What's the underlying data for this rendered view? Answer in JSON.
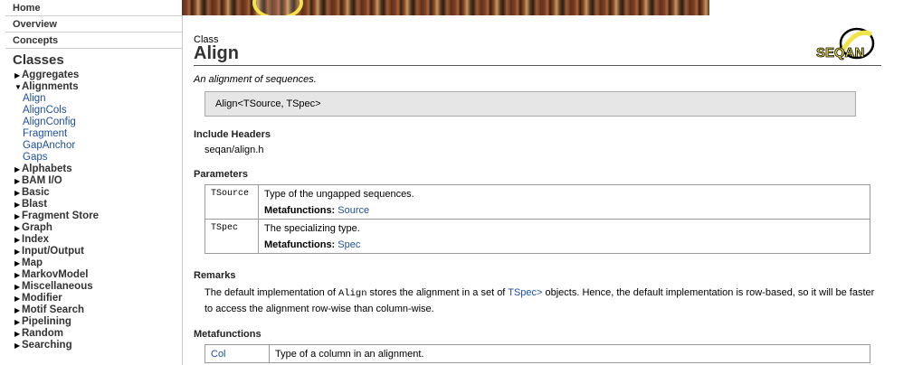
{
  "nav": {
    "links": [
      "Home",
      "Overview",
      "Concepts"
    ],
    "classes_heading": "Classes",
    "tree": [
      {
        "label": "Aggregates",
        "expanded": false
      },
      {
        "label": "Alignments",
        "expanded": true,
        "children": [
          "Align",
          "AlignCols",
          "AlignConfig",
          "Fragment",
          "GapAnchor",
          "Gaps"
        ]
      },
      {
        "label": "Alphabets",
        "expanded": false
      },
      {
        "label": "BAM I/O",
        "expanded": false
      },
      {
        "label": "Basic",
        "expanded": false
      },
      {
        "label": "Blast",
        "expanded": false
      },
      {
        "label": "Fragment Store",
        "expanded": false
      },
      {
        "label": "Graph",
        "expanded": false
      },
      {
        "label": "Index",
        "expanded": false
      },
      {
        "label": "Input/Output",
        "expanded": false
      },
      {
        "label": "Map",
        "expanded": false
      },
      {
        "label": "MarkovModel",
        "expanded": false
      },
      {
        "label": "Miscellaneous",
        "expanded": false
      },
      {
        "label": "Modifier",
        "expanded": false
      },
      {
        "label": "Motif Search",
        "expanded": false
      },
      {
        "label": "Pipelining",
        "expanded": false
      },
      {
        "label": "Random",
        "expanded": false
      },
      {
        "label": "Searching",
        "expanded": false
      }
    ]
  },
  "logo": {
    "text": "SEQAN"
  },
  "page": {
    "kind": "Class",
    "title": "Align",
    "description": "An alignment of sequences.",
    "signature": "Align<TSource, TSpec>",
    "include_heading": "Include Headers",
    "include_header": "seqan/align.h",
    "parameters_heading": "Parameters",
    "parameters": [
      {
        "name": "TSource",
        "desc": "Type of the ungapped sequences.",
        "mf_label": "Metafunctions:",
        "mf_link": "Source"
      },
      {
        "name": "TSpec",
        "desc": "The specializing type.",
        "mf_label": "Metafunctions:",
        "mf_link": "Spec"
      }
    ],
    "remarks_heading": "Remarks",
    "remarks": {
      "pre": "The default implementation of ",
      "code": "Align",
      "mid": " stores the alignment in a set of ",
      "link": "TSpec>",
      "post": " objects. Hence, the default implementation is row-based, so it will be faster to access the alignment row-wise than column-wise."
    },
    "metafunctions_heading": "Metafunctions",
    "metafunctions": [
      {
        "name": "Col",
        "desc": "Type of a column in an alignment."
      }
    ]
  },
  "colors": {
    "link": "#1e4fa0",
    "logo_yellow": "#f2e34b",
    "box_gray": "#e6e6e6"
  }
}
